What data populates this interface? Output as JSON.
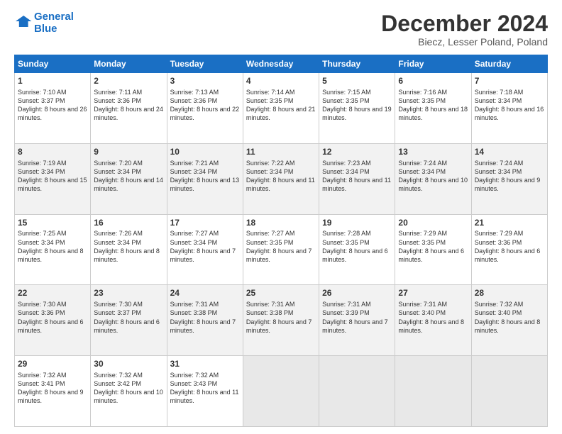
{
  "header": {
    "logo_line1": "General",
    "logo_line2": "Blue",
    "title": "December 2024",
    "subtitle": "Biecz, Lesser Poland, Poland"
  },
  "calendar": {
    "headers": [
      "Sunday",
      "Monday",
      "Tuesday",
      "Wednesday",
      "Thursday",
      "Friday",
      "Saturday"
    ],
    "weeks": [
      [
        {
          "day": "1",
          "sunrise": "7:10 AM",
          "sunset": "3:37 PM",
          "daylight": "8 hours and 26 minutes."
        },
        {
          "day": "2",
          "sunrise": "7:11 AM",
          "sunset": "3:36 PM",
          "daylight": "8 hours and 24 minutes."
        },
        {
          "day": "3",
          "sunrise": "7:13 AM",
          "sunset": "3:36 PM",
          "daylight": "8 hours and 22 minutes."
        },
        {
          "day": "4",
          "sunrise": "7:14 AM",
          "sunset": "3:35 PM",
          "daylight": "8 hours and 21 minutes."
        },
        {
          "day": "5",
          "sunrise": "7:15 AM",
          "sunset": "3:35 PM",
          "daylight": "8 hours and 19 minutes."
        },
        {
          "day": "6",
          "sunrise": "7:16 AM",
          "sunset": "3:35 PM",
          "daylight": "8 hours and 18 minutes."
        },
        {
          "day": "7",
          "sunrise": "7:18 AM",
          "sunset": "3:34 PM",
          "daylight": "8 hours and 16 minutes."
        }
      ],
      [
        {
          "day": "8",
          "sunrise": "7:19 AM",
          "sunset": "3:34 PM",
          "daylight": "8 hours and 15 minutes."
        },
        {
          "day": "9",
          "sunrise": "7:20 AM",
          "sunset": "3:34 PM",
          "daylight": "8 hours and 14 minutes."
        },
        {
          "day": "10",
          "sunrise": "7:21 AM",
          "sunset": "3:34 PM",
          "daylight": "8 hours and 13 minutes."
        },
        {
          "day": "11",
          "sunrise": "7:22 AM",
          "sunset": "3:34 PM",
          "daylight": "8 hours and 11 minutes."
        },
        {
          "day": "12",
          "sunrise": "7:23 AM",
          "sunset": "3:34 PM",
          "daylight": "8 hours and 11 minutes."
        },
        {
          "day": "13",
          "sunrise": "7:24 AM",
          "sunset": "3:34 PM",
          "daylight": "8 hours and 10 minutes."
        },
        {
          "day": "14",
          "sunrise": "7:24 AM",
          "sunset": "3:34 PM",
          "daylight": "8 hours and 9 minutes."
        }
      ],
      [
        {
          "day": "15",
          "sunrise": "7:25 AM",
          "sunset": "3:34 PM",
          "daylight": "8 hours and 8 minutes."
        },
        {
          "day": "16",
          "sunrise": "7:26 AM",
          "sunset": "3:34 PM",
          "daylight": "8 hours and 8 minutes."
        },
        {
          "day": "17",
          "sunrise": "7:27 AM",
          "sunset": "3:34 PM",
          "daylight": "8 hours and 7 minutes."
        },
        {
          "day": "18",
          "sunrise": "7:27 AM",
          "sunset": "3:35 PM",
          "daylight": "8 hours and 7 minutes."
        },
        {
          "day": "19",
          "sunrise": "7:28 AM",
          "sunset": "3:35 PM",
          "daylight": "8 hours and 6 minutes."
        },
        {
          "day": "20",
          "sunrise": "7:29 AM",
          "sunset": "3:35 PM",
          "daylight": "8 hours and 6 minutes."
        },
        {
          "day": "21",
          "sunrise": "7:29 AM",
          "sunset": "3:36 PM",
          "daylight": "8 hours and 6 minutes."
        }
      ],
      [
        {
          "day": "22",
          "sunrise": "7:30 AM",
          "sunset": "3:36 PM",
          "daylight": "8 hours and 6 minutes."
        },
        {
          "day": "23",
          "sunrise": "7:30 AM",
          "sunset": "3:37 PM",
          "daylight": "8 hours and 6 minutes."
        },
        {
          "day": "24",
          "sunrise": "7:31 AM",
          "sunset": "3:38 PM",
          "daylight": "8 hours and 7 minutes."
        },
        {
          "day": "25",
          "sunrise": "7:31 AM",
          "sunset": "3:38 PM",
          "daylight": "8 hours and 7 minutes."
        },
        {
          "day": "26",
          "sunrise": "7:31 AM",
          "sunset": "3:39 PM",
          "daylight": "8 hours and 7 minutes."
        },
        {
          "day": "27",
          "sunrise": "7:31 AM",
          "sunset": "3:40 PM",
          "daylight": "8 hours and 8 minutes."
        },
        {
          "day": "28",
          "sunrise": "7:32 AM",
          "sunset": "3:40 PM",
          "daylight": "8 hours and 8 minutes."
        }
      ],
      [
        {
          "day": "29",
          "sunrise": "7:32 AM",
          "sunset": "3:41 PM",
          "daylight": "8 hours and 9 minutes."
        },
        {
          "day": "30",
          "sunrise": "7:32 AM",
          "sunset": "3:42 PM",
          "daylight": "8 hours and 10 minutes."
        },
        {
          "day": "31",
          "sunrise": "7:32 AM",
          "sunset": "3:43 PM",
          "daylight": "8 hours and 11 minutes."
        },
        null,
        null,
        null,
        null
      ]
    ]
  }
}
